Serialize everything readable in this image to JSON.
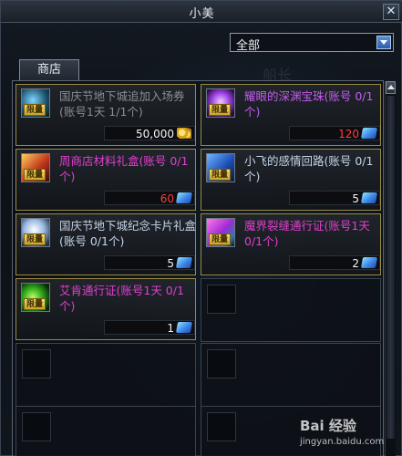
{
  "window": {
    "title": "小美",
    "close_glyph": "✕"
  },
  "filter": {
    "selected": "全部"
  },
  "tab": {
    "label": "商店"
  },
  "background_text": "船长",
  "items": [
    {
      "name": "国庆节地下城追加入场券(账号1天 1/1个)",
      "limit": "限量",
      "price": "50,000",
      "price_color": "white",
      "currency": "gold",
      "name_color": "gray",
      "icon_color": "#3aa6c9"
    },
    {
      "name": "耀眼的深渊宝珠(账号 0/1个)",
      "limit": "限量",
      "price": "120",
      "price_color": "red",
      "currency": "cera",
      "name_color": "purple",
      "icon_color": "#9a4fe6"
    },
    {
      "name": "周商店材料礼盒(账号 0/1个)",
      "limit": "限量",
      "price": "60",
      "price_color": "red",
      "currency": "cera",
      "name_color": "magenta",
      "icon_color": "#d0402a"
    },
    {
      "name": "小飞的感情回路(账号 0/1个)",
      "limit": "限量",
      "price": "5",
      "price_color": "white",
      "currency": "cera",
      "name_color": "blue",
      "icon_color": "#2d6fd6"
    },
    {
      "name": "国庆节地下城纪念卡片礼盒(账号 0/1个)",
      "limit": "限量",
      "price": "5",
      "price_color": "white",
      "currency": "cera",
      "name_color": "blue",
      "icon_color": "#7fa7d8"
    },
    {
      "name": "魔界裂缝通行证(账号1天 0/1个)",
      "limit": "限量",
      "price": "2",
      "price_color": "white",
      "currency": "cera",
      "name_color": "magenta",
      "icon_color": "#c23ad8"
    },
    {
      "name": "艾肯通行证(账号1天 0/1个)",
      "limit": "限量",
      "price": "1",
      "price_color": "white",
      "currency": "cera",
      "name_color": "magenta",
      "icon_color": "#3bd23a"
    }
  ],
  "watermark": {
    "brand": "Bai 经验",
    "url": "jingyan.baidu.com"
  }
}
